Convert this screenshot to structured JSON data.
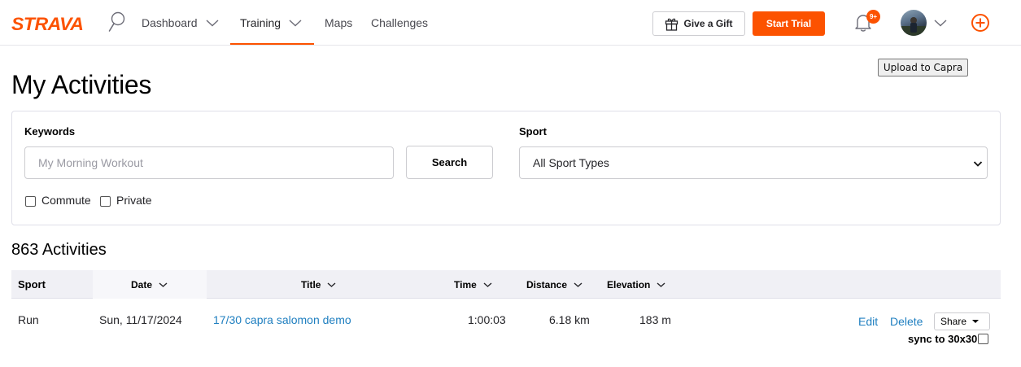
{
  "nav": {
    "logo": "STRAVA",
    "items": [
      {
        "label": "Dashboard"
      },
      {
        "label": "Training"
      },
      {
        "label": "Maps"
      },
      {
        "label": "Challenges"
      }
    ],
    "active_item": "Training",
    "gift_label": "Give a Gift",
    "trial_label": "Start Trial",
    "notification_badge": "9+",
    "icons": [
      "search-icon",
      "bell-icon",
      "avatar",
      "plus-circle-icon"
    ]
  },
  "upload_label": "Upload to Capra",
  "page_title": "My Activities",
  "filters": {
    "keywords_label": "Keywords",
    "keywords_placeholder": "My Morning Workout",
    "keywords_value": "",
    "search_label": "Search",
    "sport_label": "Sport",
    "sport_selected": "All Sport Types",
    "checkboxes": [
      {
        "label": "Commute",
        "checked": false
      },
      {
        "label": "Private",
        "checked": false
      }
    ]
  },
  "activities_count": "863 Activities",
  "table": {
    "headers": [
      "Sport",
      "Date",
      "Title",
      "Time",
      "Distance",
      "Elevation"
    ],
    "rows": [
      {
        "sport": "Run",
        "date": "Sun, 11/17/2024",
        "title": "17/30 capra salomon demo",
        "time": "1:00:03",
        "distance": "6.18 km",
        "elevation": "183 m"
      }
    ],
    "actions": {
      "edit": "Edit",
      "delete": "Delete",
      "share": "Share"
    },
    "sync_label": "sync to 30x30"
  },
  "colors": {
    "brand": "#fc5200",
    "link": "#1f7fc0",
    "header_bg": "#f0f0f5"
  }
}
